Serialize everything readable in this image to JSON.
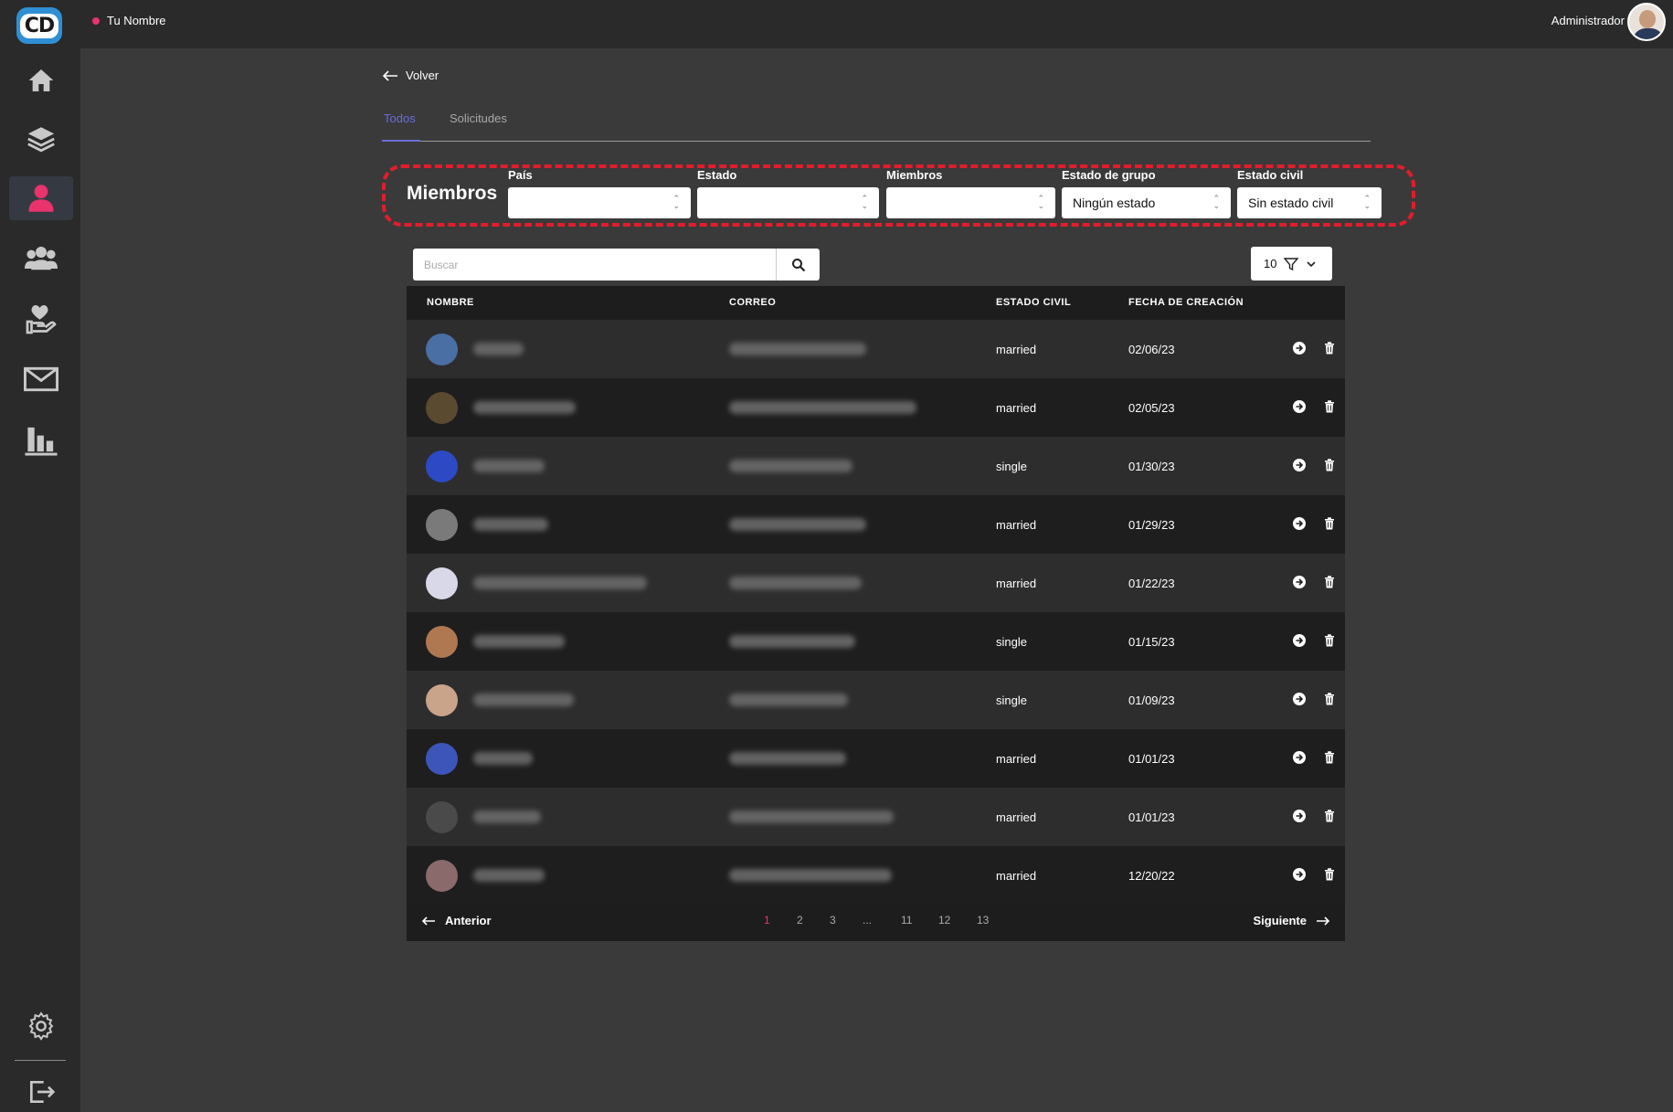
{
  "sidebar": {
    "logo": "CD",
    "items": [
      {
        "name": "home-icon"
      },
      {
        "name": "layers-icon"
      },
      {
        "name": "user-icon",
        "active": true
      },
      {
        "name": "group-icon"
      },
      {
        "name": "heart-hand-icon"
      },
      {
        "name": "mail-icon"
      },
      {
        "name": "bar-chart-icon"
      }
    ],
    "bottom": [
      {
        "name": "settings-icon"
      },
      {
        "name": "logout-icon"
      }
    ]
  },
  "topbar": {
    "name": "Tu Nombre",
    "role": "Administrador"
  },
  "back": {
    "label": "Volver"
  },
  "tabs": [
    {
      "label": "Todos",
      "active": true
    },
    {
      "label": "Solicitudes"
    }
  ],
  "filters": {
    "title": "Miembros",
    "pais": {
      "label": "País",
      "value": ""
    },
    "estado": {
      "label": "Estado",
      "value": ""
    },
    "miembros": {
      "label": "Miembros",
      "value": ""
    },
    "estado_grupo": {
      "label": "Estado de grupo",
      "value": "Ningún estado"
    },
    "estado_civil": {
      "label": "Estado civil",
      "value": "Sin estado civil"
    }
  },
  "search": {
    "placeholder": "Buscar"
  },
  "per_page": "10",
  "table": {
    "headers": {
      "nombre": "NOMBRE",
      "correo": "CORREO",
      "estado_civil": "ESTADO CIVIL",
      "fecha": "FECHA DE CREACIÓN"
    },
    "rows": [
      {
        "estado_civil": "married",
        "fecha": "02/06/23",
        "avatar_color": "#4a6fa5"
      },
      {
        "estado_civil": "married",
        "fecha": "02/05/23",
        "avatar_color": "#5a4a30"
      },
      {
        "estado_civil": "single",
        "fecha": "01/30/23",
        "avatar_color": "#2d49c4"
      },
      {
        "estado_civil": "married",
        "fecha": "01/29/23",
        "avatar_color": "#7a7a7a"
      },
      {
        "estado_civil": "married",
        "fecha": "01/22/23",
        "avatar_color": "#d8d8e8"
      },
      {
        "estado_civil": "single",
        "fecha": "01/15/23",
        "avatar_color": "#b07850"
      },
      {
        "estado_civil": "single",
        "fecha": "01/09/23",
        "avatar_color": "#c9a48a"
      },
      {
        "estado_civil": "married",
        "fecha": "01/01/23",
        "avatar_color": "#3d55b8"
      },
      {
        "estado_civil": "married",
        "fecha": "01/01/23",
        "avatar_color": "#4a4a4a"
      },
      {
        "estado_civil": "married",
        "fecha": "12/20/22",
        "avatar_color": "#8a6a6a"
      }
    ]
  },
  "pagination": {
    "prev": "Anterior",
    "next": "Siguiente",
    "pages": [
      "1",
      "2",
      "3",
      "...",
      "11",
      "12",
      "13"
    ],
    "active": "1"
  },
  "colors": {
    "accent": "#e8336d",
    "tab_active": "#6b6ed8",
    "highlight_frame": "#e11d2c"
  }
}
